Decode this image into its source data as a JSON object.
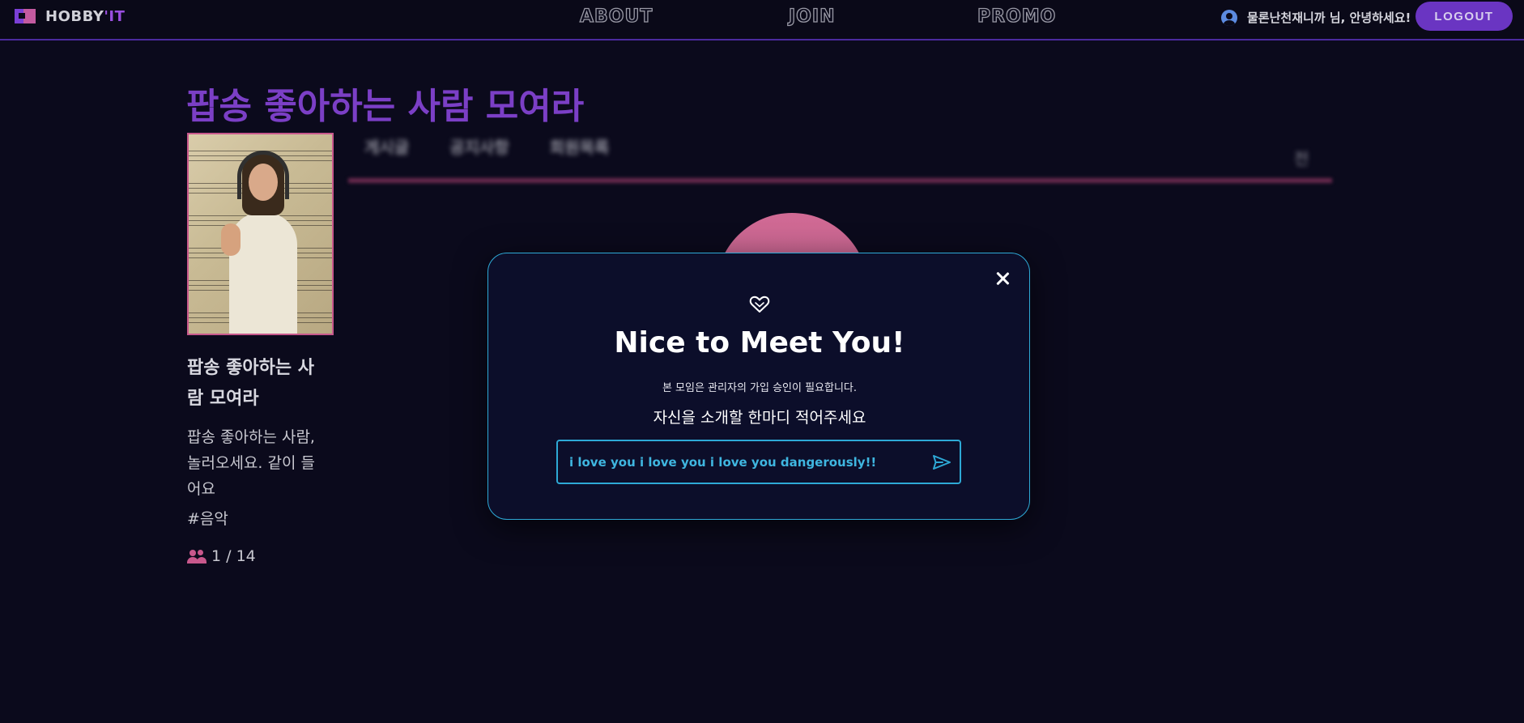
{
  "header": {
    "logo_text": "HOBBY",
    "logo_accent": "'IT",
    "nav": [
      "ABOUT",
      "JOIN",
      "PROMO"
    ],
    "greeting": "물론난천재니까 님, 안녕하세요!",
    "logout_label": "LOGOUT",
    "user_icon": "account-circle-icon"
  },
  "group": {
    "title": "팝송 좋아하는 사람 모여라",
    "side_title": "팝송 좋아하는 사람 모여라",
    "description": "팝송 좋아하는 사람, 놀러오세요. 같이 들어요",
    "tag": "#음악",
    "members": "1 / 14",
    "members_icon": "people-icon"
  },
  "tabs": [
    "게시글",
    "공지사항",
    "회원목록"
  ],
  "tab_extra": "전",
  "modal": {
    "heart_icon": "heart-icon",
    "title": "Nice to Meet You!",
    "note": "본 모임은 관리자의 가입 승인이 필요합니다.",
    "prompt": "자신을 소개할 한마디 적어주세요",
    "input_value": "i love you i love you i love you dangerously!!",
    "send_icon": "send-icon",
    "close_icon": "close-icon"
  },
  "colors": {
    "background": "#0b0a1c",
    "accent_purple": "#7b3fc6",
    "accent_cyan": "#2ea9d6",
    "accent_pink": "#c8588c"
  }
}
